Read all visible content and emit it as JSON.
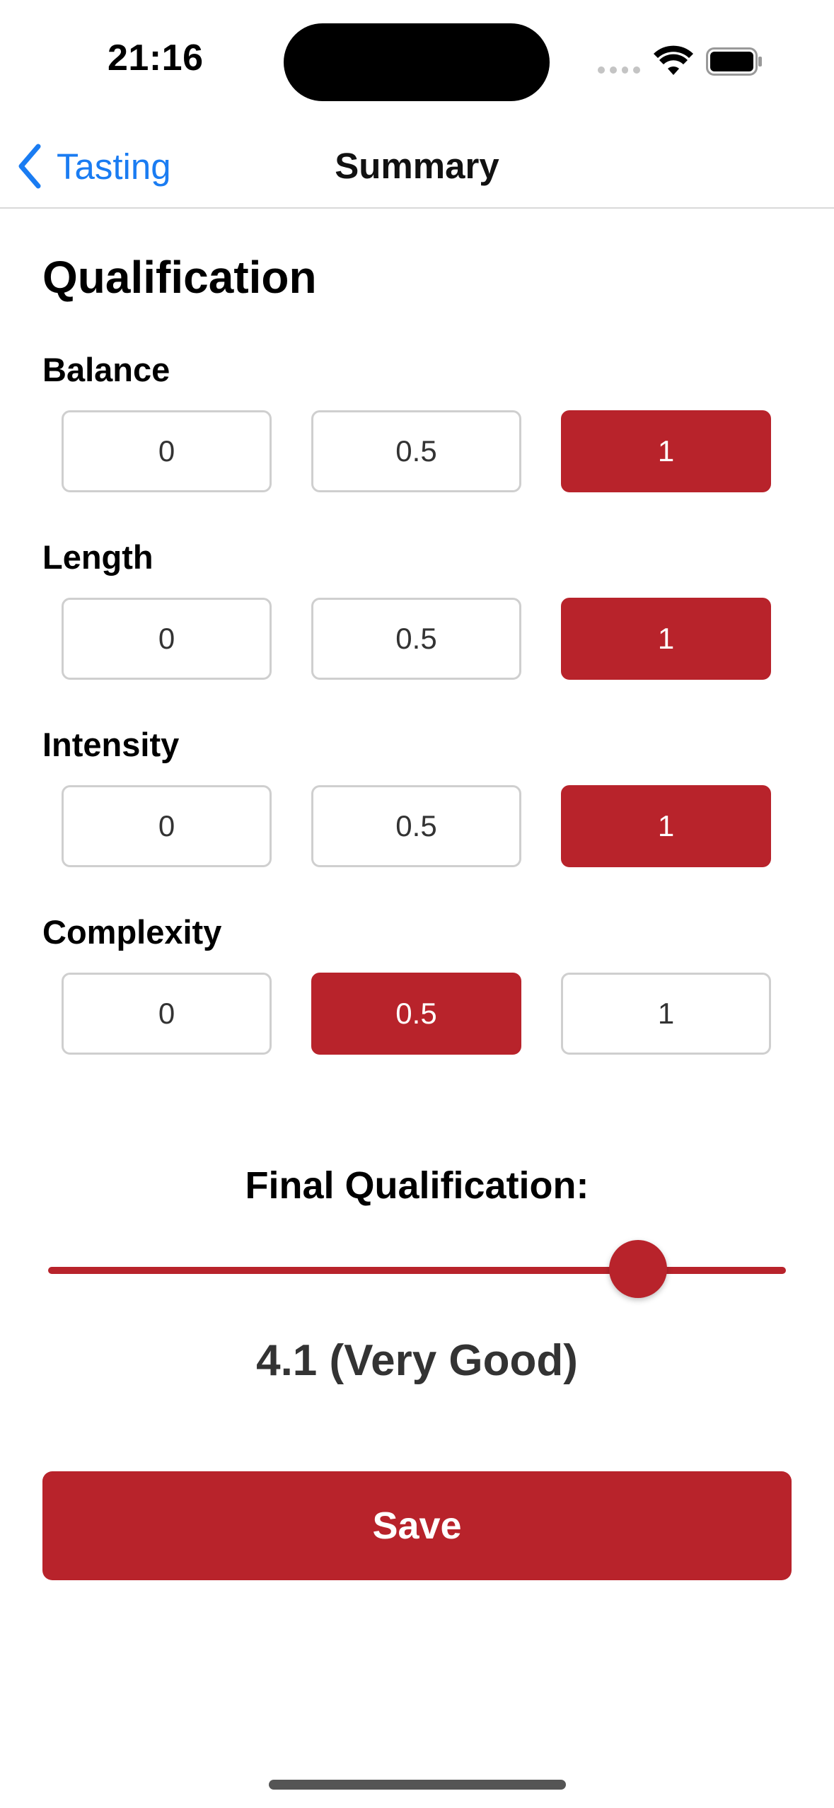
{
  "status_bar": {
    "time": "21:16"
  },
  "nav": {
    "back_label": "Tasting",
    "back_icon": "chevron-left-icon",
    "title": "Summary"
  },
  "section_title": "Qualification",
  "criteria": [
    {
      "label": "Balance",
      "options": [
        "0",
        "0.5",
        "1"
      ],
      "selected": "1"
    },
    {
      "label": "Length",
      "options": [
        "0",
        "0.5",
        "1"
      ],
      "selected": "1"
    },
    {
      "label": "Intensity",
      "options": [
        "0",
        "0.5",
        "1"
      ],
      "selected": "1"
    },
    {
      "label": "Complexity",
      "options": [
        "0",
        "0.5",
        "1"
      ],
      "selected": "0.5"
    }
  ],
  "final": {
    "label": "Final Qualification:",
    "slider_fraction": 0.8,
    "score_text": "4.1 (Very Good)"
  },
  "save_label": "Save",
  "colors": {
    "accent": "#b8232b",
    "link": "#1a7cf2"
  }
}
